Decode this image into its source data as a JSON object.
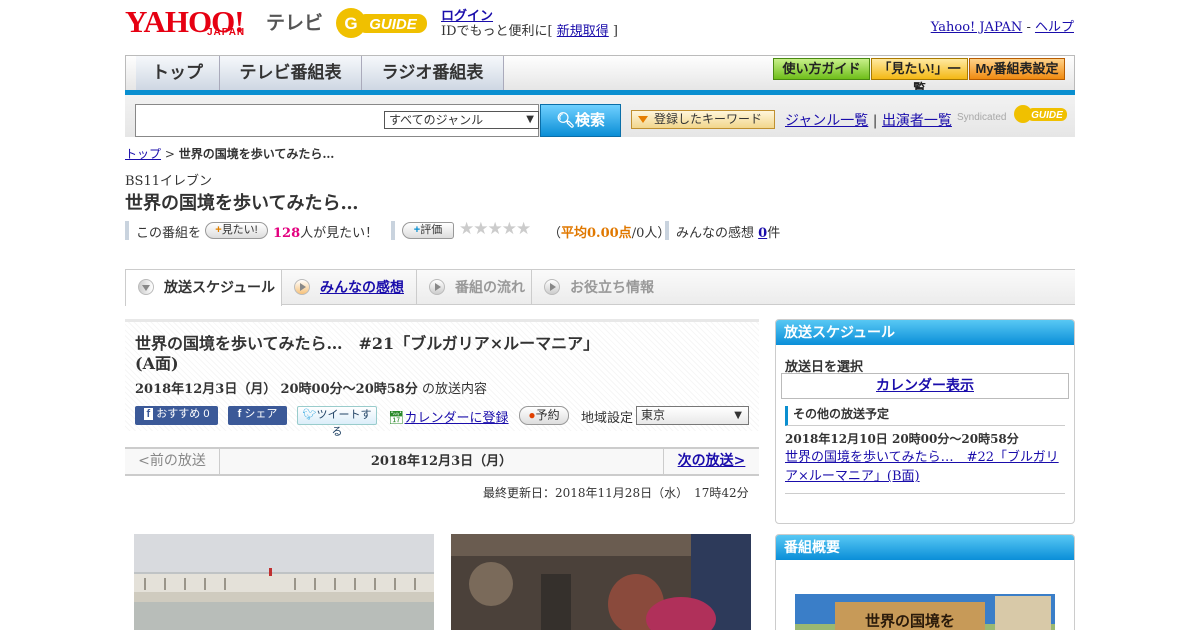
{
  "header": {
    "yahoo_logo": "YAHOO!",
    "japan_logo": "JAPAN",
    "tv_label": "テレビ",
    "gguide_logo": "GUIDE",
    "login_link": "ログイン",
    "login_text": "IDでもっと便利に[ ",
    "register_link": "新規取得",
    "login_tail": " ]",
    "yahoo_japan_link": "Yahoo! JAPAN",
    "separator": " - ",
    "help_link": "ヘルプ"
  },
  "nav": {
    "tabs": [
      "トップ",
      "テレビ番組表",
      "ラジオ番組表"
    ],
    "guide_buttons": [
      "使い方ガイド",
      "「見たい!」一覧",
      "My番組表設定"
    ]
  },
  "search": {
    "genre_select": "すべてのジャンル",
    "search_button": "検索",
    "keyword_button": "登録したキーワード",
    "genre_list_link": "ジャンル一覧",
    "divider": "|",
    "performer_list_link": "出演者一覧",
    "syndicated": "Syndicated"
  },
  "breadcrumb": {
    "top": "トップ",
    "sep": " > ",
    "current": "世界の国境を歩いてみたら…"
  },
  "program": {
    "channel": "BS11イレブン",
    "title": "世界の国境を歩いてみたら…",
    "want_prefix": "この番組を",
    "want_button": "見たい!",
    "want_count": "128",
    "want_suffix": "人が見たい！",
    "rate_button": "評価",
    "stars": "★★★★★",
    "avg_open": "（",
    "avg_label": "平均0.00点",
    "avg_count": "/0人",
    "avg_close": "）",
    "impressions_label": "みんなの感想 ",
    "impressions_count": "0",
    "impressions_unit": "件"
  },
  "program_tabs": [
    "放送スケジュール",
    "みんなの感想",
    "番組の流れ",
    "お役立ち情報"
  ],
  "episode": {
    "title": "世界の国境を歩いてみたら…　#21「ブルガリア×ルーマニア」(A面)",
    "date": "2018年12月3日（月）",
    "time": "20時00分～20時58分",
    "content_label": " の放送内容",
    "share_recommend": "おすすめ 0",
    "share_facebook": "シェア",
    "share_tweet": "ツイートする",
    "calendar_link": "カレンダーに登録",
    "reserve_button": "予約",
    "region_label": "地域設定",
    "region_value": "東京",
    "prev_broadcast": "<前の放送",
    "pager_date": "2018年12月3日（月）",
    "next_broadcast": "次の放送>",
    "updated": "最終更新日：2018年11月28日（水）　17時42分"
  },
  "sidebar": {
    "schedule_heading": "放送スケジュール",
    "select_date": "放送日を選択",
    "calendar_link": "カレンダー表示",
    "other_heading": "その他の放送予定",
    "other_datetime": "2018年12月10日  20時00分～20時58分",
    "other_link": "世界の国境を歩いてみたら…　#22「ブルガリア×ルーマニア」(B面)",
    "summary_heading": "番組概要",
    "summary_image_text": "世界の国境を"
  },
  "colors": {
    "accent_blue": "#0a8fd0",
    "want_count": "#e3007f",
    "avg_orange": "#e07800",
    "yahoo_red": "#e60012"
  }
}
